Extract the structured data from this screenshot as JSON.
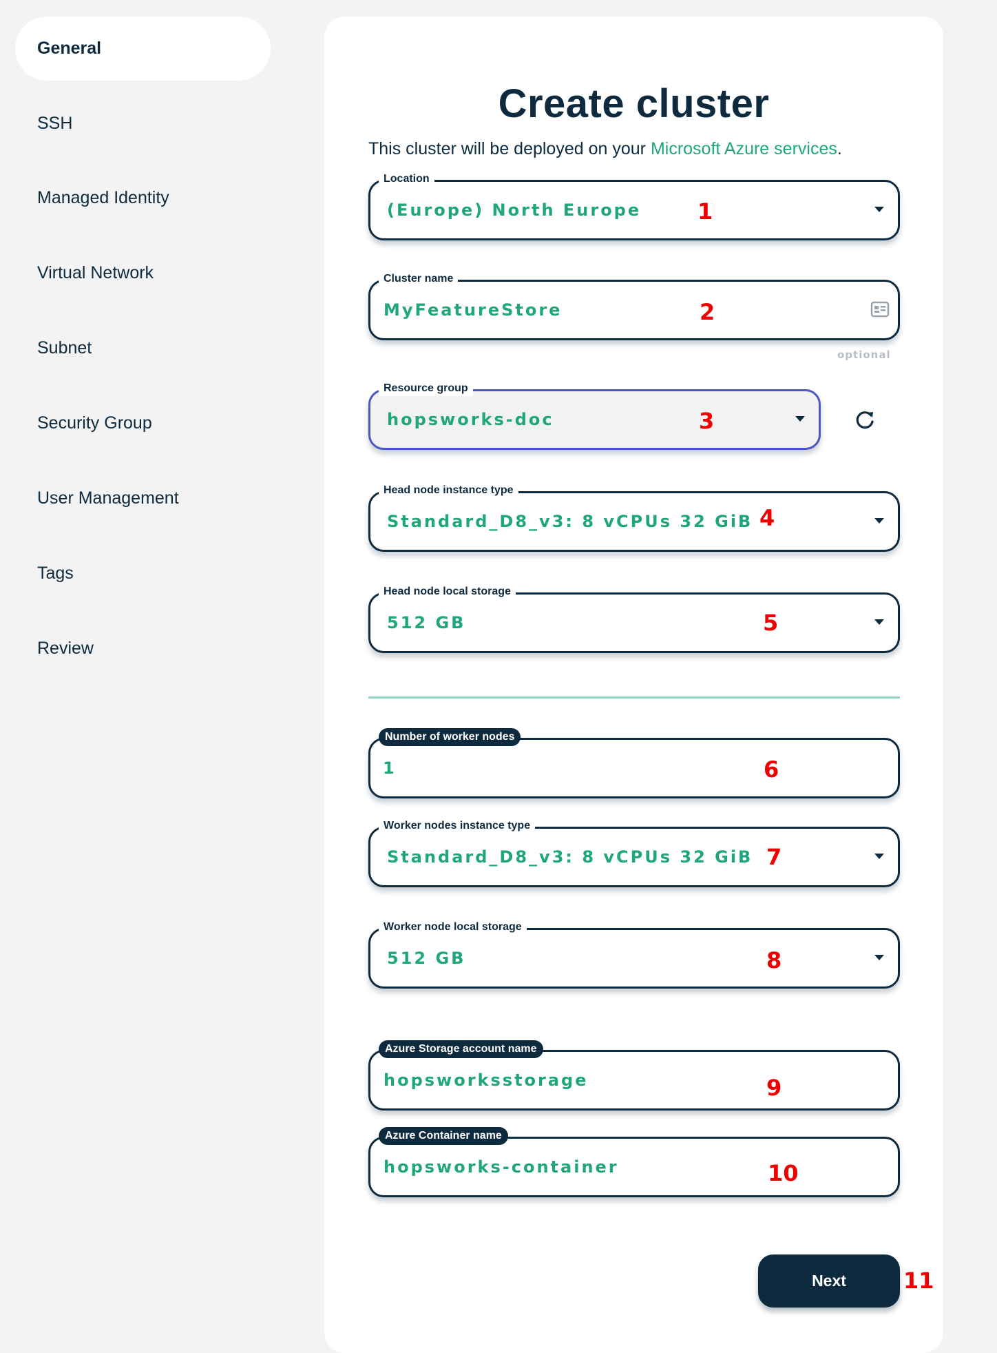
{
  "sidebar": {
    "items": [
      {
        "label": "General",
        "active": true
      },
      {
        "label": "SSH"
      },
      {
        "label": "Managed Identity"
      },
      {
        "label": "Virtual Network"
      },
      {
        "label": "Subnet"
      },
      {
        "label": "Security Group"
      },
      {
        "label": "User Management"
      },
      {
        "label": "Tags"
      },
      {
        "label": "Review"
      }
    ]
  },
  "main": {
    "title": "Create cluster",
    "intro_prefix": "This cluster will be deployed on your ",
    "intro_link": "Microsoft Azure services",
    "intro_suffix": ".",
    "fields": {
      "location": {
        "label": "Location",
        "value": "(Europe) North Europe",
        "marker": "1"
      },
      "cluster_name": {
        "label": "Cluster name",
        "value": "MyFeatureStore",
        "marker": "2",
        "hint": "optional",
        "icon": "id-card-icon"
      },
      "resource_group": {
        "label": "Resource group",
        "value": "hopsworks-doc",
        "marker": "3",
        "refresh_icon": "refresh-icon"
      },
      "head_instance_type": {
        "label": "Head node instance type",
        "value": "Standard_D8_v3: 8 vCPUs 32 GiB",
        "marker": "4"
      },
      "head_storage": {
        "label": "Head node local storage",
        "value": "512 GB",
        "marker": "5"
      },
      "worker_count": {
        "label": "Number of worker nodes",
        "value": "1",
        "marker": "6"
      },
      "worker_instance_type": {
        "label": "Worker nodes instance type",
        "value": "Standard_D8_v3: 8 vCPUs 32 GiB",
        "marker": "7"
      },
      "worker_storage": {
        "label": "Worker node local storage",
        "value": "512 GB",
        "marker": "8"
      },
      "storage_account": {
        "label": "Azure Storage account name",
        "value": "hopsworksstorage",
        "marker": "9"
      },
      "container_name": {
        "label": "Azure Container name",
        "value": "hopsworks-container",
        "marker": "10"
      }
    },
    "next_label": "Next",
    "next_marker": "11"
  },
  "colors": {
    "primary": "#0e2a3f",
    "accent": "#1fa67c",
    "marker": "#ee0000",
    "focus_border": "#4a57c4",
    "background": "#f3f3f3"
  }
}
